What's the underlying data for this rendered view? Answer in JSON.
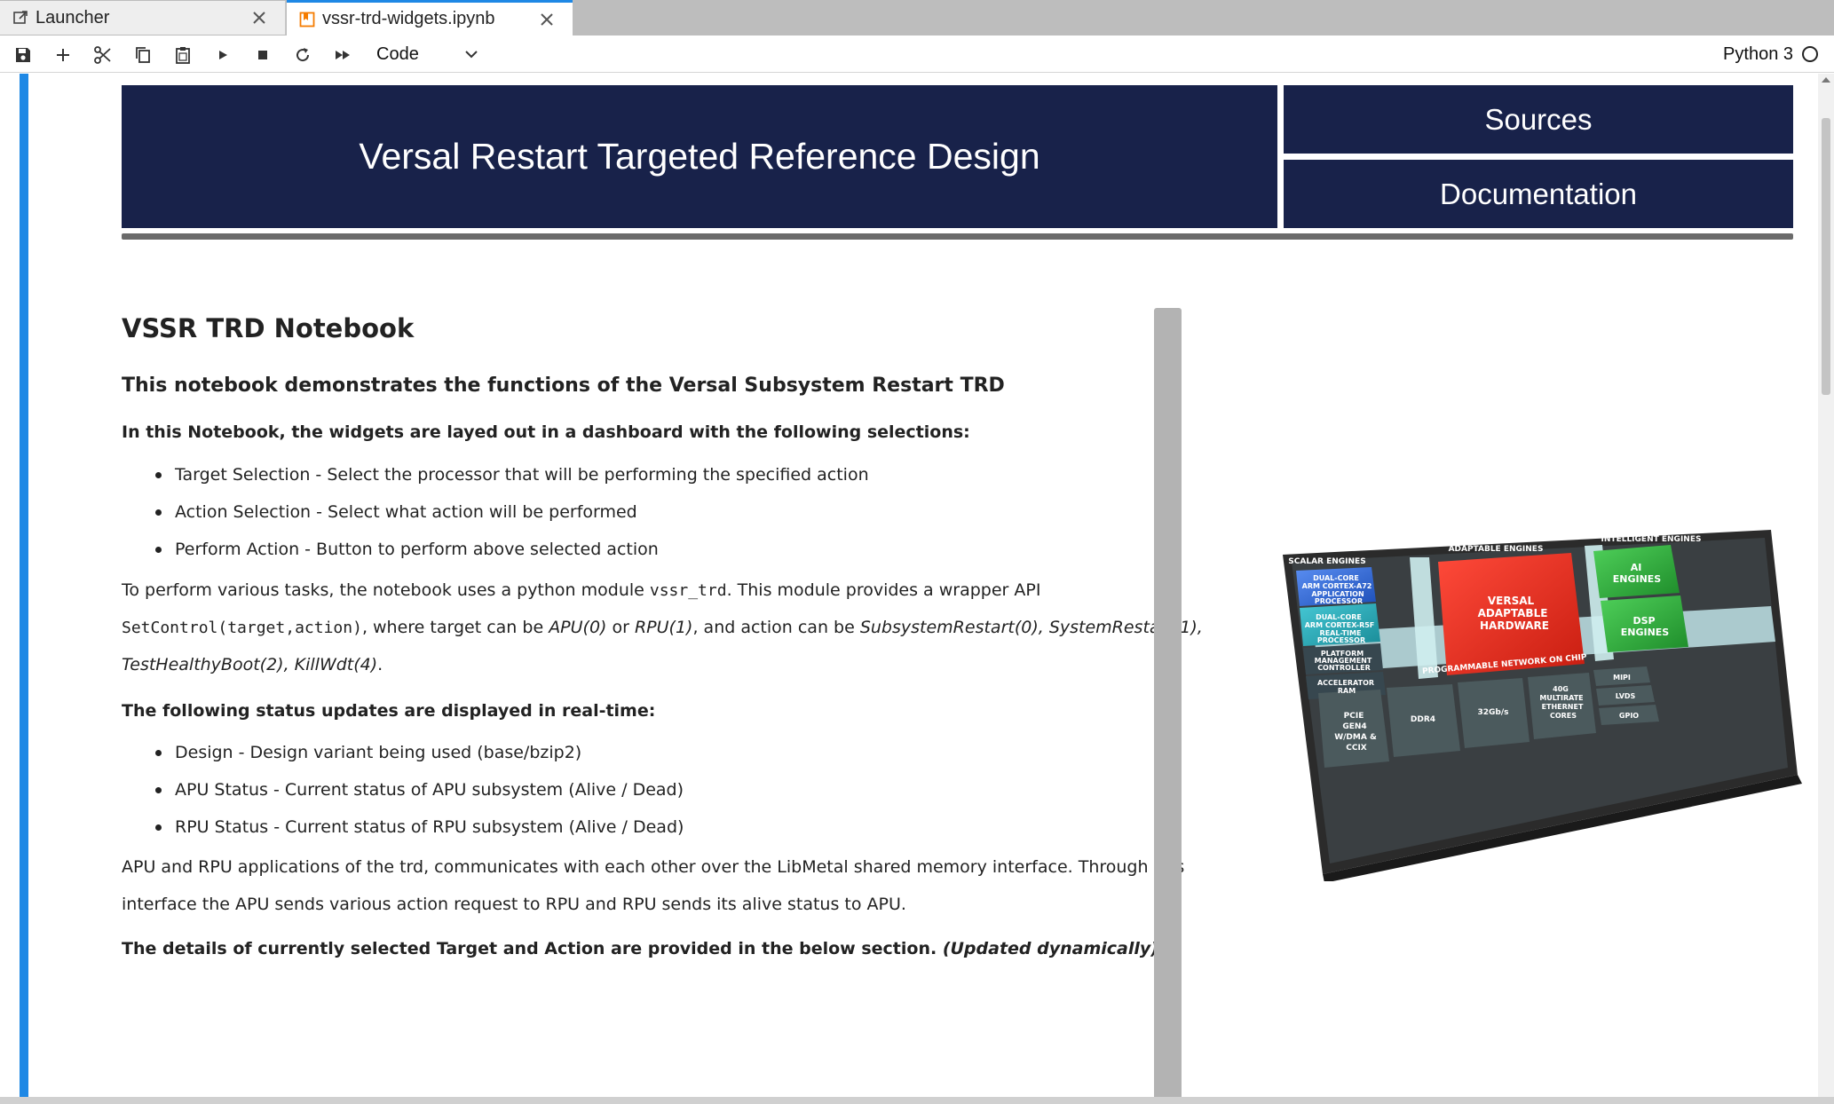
{
  "tabs": [
    {
      "label": "Launcher",
      "icon": "external-link-icon",
      "active": false
    },
    {
      "label": "vssr-trd-widgets.ipynb",
      "icon": "notebook-icon",
      "active": true
    }
  ],
  "toolbar": {
    "buttons": [
      "save-icon",
      "add-icon",
      "cut-icon",
      "copy-icon",
      "paste-icon",
      "run-icon",
      "stop-icon",
      "restart-icon",
      "fast-forward-icon"
    ],
    "cell_type": "Code",
    "kernel": "Python 3"
  },
  "banner": {
    "title": "Versal Restart Targeted Reference Design",
    "sources": "Sources",
    "documentation": "Documentation",
    "color": "#18224a"
  },
  "content": {
    "heading": "VSSR TRD Notebook",
    "subheading": "This notebook demonstrates the functions of the Versal Subsystem Restart TRD",
    "widgets_intro": "In this Notebook, the widgets are layed out in a dashboard with the following selections:",
    "widget_items": [
      "Target Selection - Select the processor that will be performing the specified action",
      "Action Selection - Select what action will be performed",
      "Perform Action - Button to perform above selected action"
    ],
    "para1_a": "To perform various tasks, the notebook uses a python module ",
    "para1_code1": "vssr_trd",
    "para1_b": ". This module provides a wrapper API",
    "para1_code2": "SetControl(target,action)",
    "para1_c": ", where target can be ",
    "para1_i1": "APU(0)",
    "para1_d": " or ",
    "para1_i2": "RPU(1)",
    "para1_e": ", and action can be ",
    "para1_i3": "SubsystemRestart(0), SystemRestart(1),",
    "para1_i4": "TestHealthyBoot(2), KillWdt(4)",
    "para1_f": ".",
    "status_intro": "The following status updates are displayed in real-time:",
    "status_items": [
      "Design - Design variant being used (base/bzip2)",
      "APU Status - Current status of APU subsystem (Alive / Dead)",
      "RPU Status - Current status of RPU subsystem (Alive / Dead)"
    ],
    "para2_line1": "APU and RPU applications of the trd, communicates with each other over the LibMetal shared memory interface. Through this",
    "para2_line2": "interface the APU sends various action request to RPU and RPU sends its alive status to APU.",
    "details_a": "The details of currently selected Target and Action are provided in the below section. ",
    "details_b": "(Updated dynamically)"
  },
  "chip": {
    "scalar_engines": "SCALAR ENGINES",
    "adaptable_engines": "ADAPTABLE ENGINES",
    "intelligent_engines": "INTELLIGENT ENGINES",
    "apu": [
      "DUAL-CORE",
      "ARM CORTEX-A72",
      "APPLICATION",
      "PROCESSOR"
    ],
    "rpu": [
      "DUAL-CORE",
      "ARM CORTEX-R5F",
      "REAL-TIME",
      "PROCESSOR"
    ],
    "pmc": [
      "PLATFORM",
      "MANAGEMENT",
      "CONTROLLER"
    ],
    "ram": [
      "ACCELERATOR",
      "RAM"
    ],
    "versal": [
      "VERSAL",
      "ADAPTABLE",
      "HARDWARE"
    ],
    "ai": [
      "AI",
      "ENGINES"
    ],
    "dsp": [
      "DSP",
      "ENGINES"
    ],
    "noc": "PROGRAMMABLE NETWORK ON CHIP",
    "pcie": [
      "PCIE",
      "GEN4",
      "W/DMA &",
      "CCIX"
    ],
    "ddr4": "DDR4",
    "gbps": "32Gb/s",
    "ethernet": [
      "40G",
      "MULTIRATE",
      "ETHERNET",
      "CORES"
    ],
    "mipi": "MIPI",
    "lvds": "LVDS",
    "gpio": "GPIO"
  }
}
